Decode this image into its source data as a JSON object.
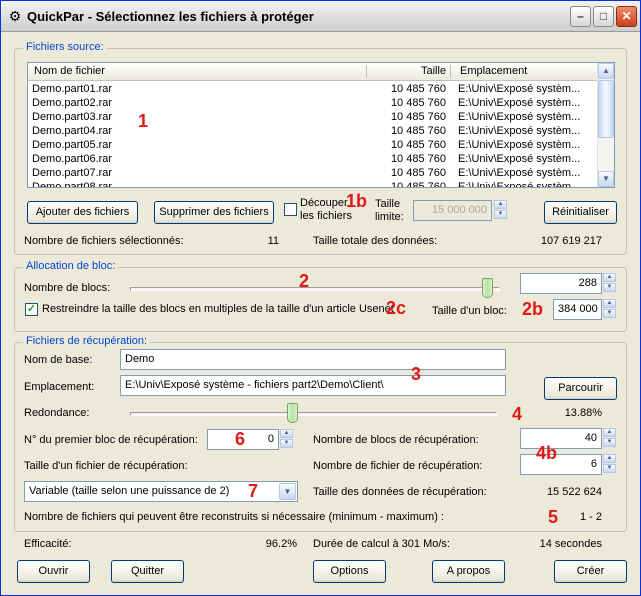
{
  "window": {
    "title": "QuickPar - Sélectionnez les fichiers à protéger",
    "app_icon": "quickpar-gear-icon"
  },
  "source": {
    "group_title": "Fichiers source:",
    "columns": [
      "Nom de fichier",
      "Taille",
      "Emplacement"
    ],
    "files": [
      {
        "name": "Demo.part01.rar",
        "size": "10 485 760",
        "location": "E:\\Univ\\Exposé systèm..."
      },
      {
        "name": "Demo.part02.rar",
        "size": "10 485 760",
        "location": "E:\\Univ\\Exposé systèm..."
      },
      {
        "name": "Demo.part03.rar",
        "size": "10 485 760",
        "location": "E:\\Univ\\Exposé systèm..."
      },
      {
        "name": "Demo.part04.rar",
        "size": "10 485 760",
        "location": "E:\\Univ\\Exposé systèm..."
      },
      {
        "name": "Demo.part05.rar",
        "size": "10 485 760",
        "location": "E:\\Univ\\Exposé systèm..."
      },
      {
        "name": "Demo.part06.rar",
        "size": "10 485 760",
        "location": "E:\\Univ\\Exposé systèm..."
      },
      {
        "name": "Demo.part07.rar",
        "size": "10 485 760",
        "location": "E:\\Univ\\Exposé systèm..."
      },
      {
        "name": "Demo.part08.rar",
        "size": "10 485 760",
        "location": "E:\\Univ\\Exposé systèm..."
      }
    ],
    "add_button": "Ajouter des fichiers",
    "remove_button": "Supprimer des fichiers",
    "split_label_1": "Découper",
    "split_label_2": "les fichiers",
    "size_limit_label_1": "Taille",
    "size_limit_label_2": "limite:",
    "size_limit_value": "15 000 000",
    "reset_button": "Réinitialiser",
    "selected_count_label": "Nombre de fichiers sélectionnés:",
    "selected_count": "11",
    "total_size_label": "Taille totale des données:",
    "total_size": "107 619 217"
  },
  "allocation": {
    "group_title": "Allocation de bloc:",
    "block_count_label": "Nombre de blocs:",
    "block_count": "288",
    "block_slider_fraction": 0.98,
    "restrict_checked": true,
    "restrict_label": "Restreindre la taille des blocs en multiples de la taille d'un article Usenet",
    "block_size_label": "Taille d'un bloc:",
    "block_size": "384 000"
  },
  "recovery": {
    "group_title": "Fichiers de récupération:",
    "base_name_label": "Nom de base:",
    "base_name": "Demo",
    "location_label": "Emplacement:",
    "location": "E:\\Univ\\Exposé système - fichiers part2\\Demo\\Client\\",
    "browse_button": "Parcourir",
    "redundancy_label": "Redondance:",
    "redundancy_fraction": 0.44,
    "redundancy_value": "13.88%",
    "first_block_label": "N° du premier bloc de récupération:",
    "first_block": "0",
    "recovery_block_count_label": "Nombre de blocs de récupération:",
    "recovery_block_count": "40",
    "file_size_label": "Taille d'un fichier de récupération:",
    "recovery_file_count_label": "Nombre de fichier de récupération:",
    "recovery_file_count": "6",
    "size_mode": "Variable (taille selon une puissance de 2)",
    "recovery_data_size_label": "Taille des données de récupération:",
    "recovery_data_size": "15 522 624",
    "reconstructable_label": "Nombre de fichiers qui peuvent être reconstruits si nécessaire (minimum - maximum) :",
    "reconstructable_value": "1 - 2"
  },
  "footer": {
    "efficiency_label": "Efficacité:",
    "efficiency_value": "96.2%",
    "duration_label": "Durée de calcul à 301 Mo/s:",
    "duration_value": "14 secondes",
    "open_button": "Ouvrir",
    "quit_button": "Quitter",
    "options_button": "Options",
    "about_button": "A propos",
    "create_button": "Créer"
  },
  "annotations": {
    "m1": "1",
    "m1b": "1b",
    "m2": "2",
    "m2b": "2b",
    "m2c": "2c",
    "m3": "3",
    "m4": "4",
    "m4b": "4b",
    "m5": "5",
    "m6": "6",
    "m7": "7"
  },
  "colors": {
    "annotation": "#e0191a",
    "group_title": "#0046d5",
    "window_bg": "#ece9d8"
  }
}
